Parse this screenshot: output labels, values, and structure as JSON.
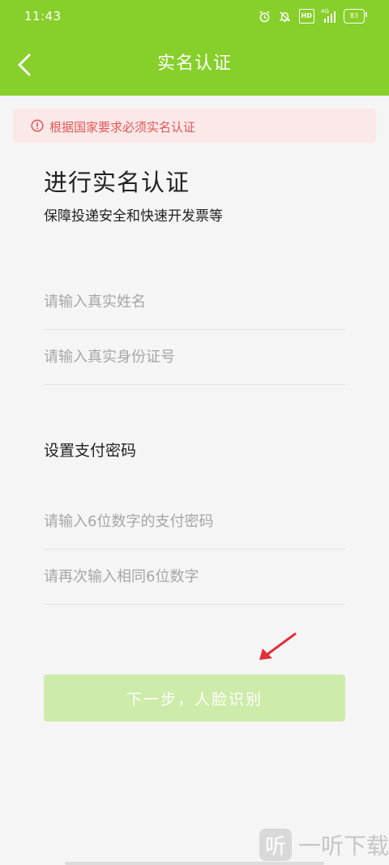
{
  "status_bar": {
    "time": "11:43",
    "hd": "HD",
    "signal": "4G",
    "battery": "83"
  },
  "nav": {
    "title": "实名认证"
  },
  "alert": {
    "text": "根据国家要求必须实名认证",
    "color": "#e45656"
  },
  "form": {
    "heading": "进行实名认证",
    "subheading": "保障投递安全和快速开发票等",
    "name_placeholder": "请输入真实姓名",
    "id_placeholder": "请输入真实身份证号",
    "payment_section_title": "设置支付密码",
    "pwd_placeholder": "请输入6位数字的支付密码",
    "pwd_confirm_placeholder": "请再次输入相同6位数字",
    "next_button": "下一步，人脸识别"
  },
  "watermark": {
    "logo_char": "听",
    "text": "一听下载"
  },
  "colors": {
    "brand": "#87cf2a",
    "button_disabled": "#cdeba9",
    "annotation_arrow": "#e0303a"
  }
}
